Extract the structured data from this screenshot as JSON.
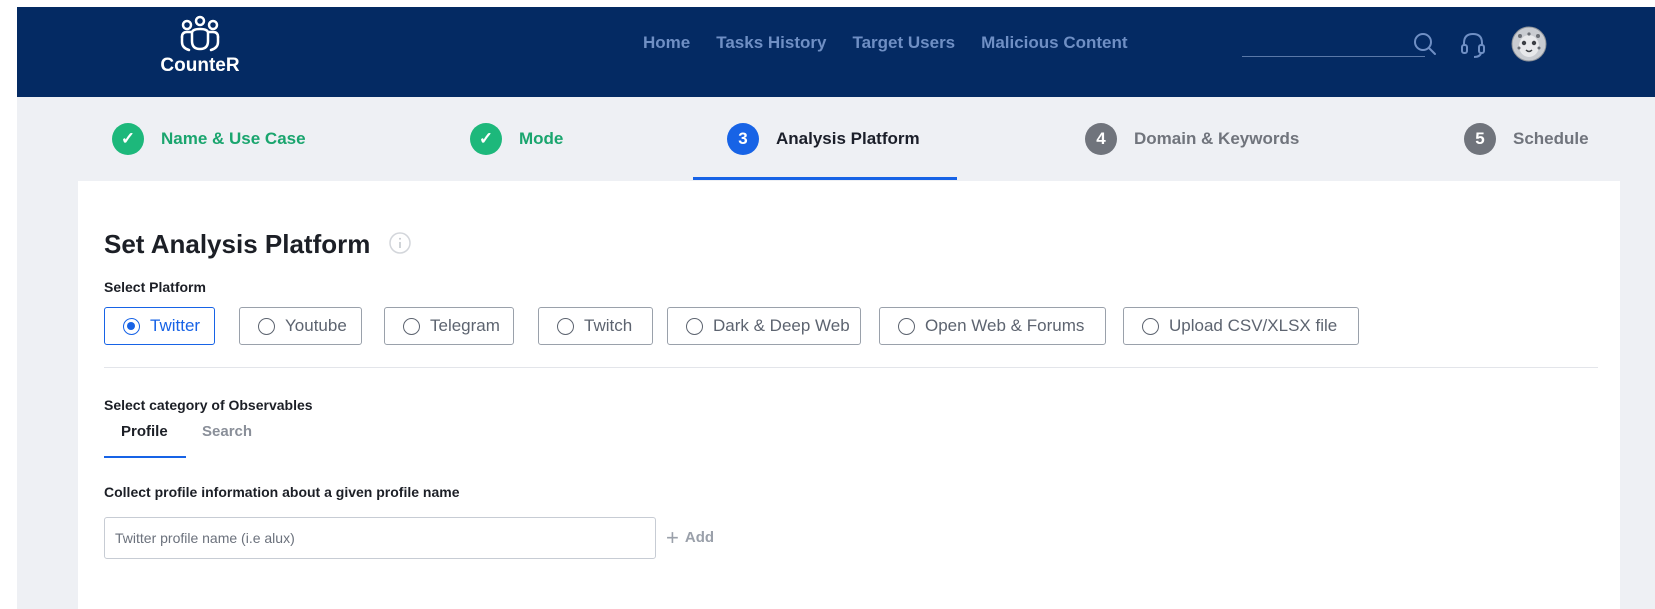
{
  "app": {
    "name": "CounteR",
    "logo_icon": "people-group-icon"
  },
  "nav": {
    "items": [
      "Home",
      "Tasks History",
      "Target Users",
      "Malicious Content"
    ],
    "icons": [
      "search-icon",
      "headset-icon",
      "avatar"
    ]
  },
  "stepper": {
    "steps": [
      {
        "badge": "✓",
        "label": "Name & Use Case",
        "state": "done"
      },
      {
        "badge": "✓",
        "label": "Mode",
        "state": "done"
      },
      {
        "badge": "3",
        "label": "Analysis Platform",
        "state": "active"
      },
      {
        "badge": "4",
        "label": "Domain & Keywords",
        "state": "pending"
      },
      {
        "badge": "5",
        "label": "Schedule",
        "state": "pending"
      }
    ]
  },
  "main": {
    "title": "Set Analysis Platform",
    "select_platform_label": "Select Platform",
    "platforms": [
      "Twitter",
      "Youtube",
      "Telegram",
      "Twitch",
      "Dark & Deep Web",
      "Open Web & Forums",
      "Upload CSV/XLSX file"
    ],
    "selected_platform": "Twitter",
    "category_label": "Select category of Observables",
    "tabs": [
      "Profile",
      "Search"
    ],
    "active_tab": "Profile",
    "collect_label": "Collect profile information about a given profile name",
    "profile_input": {
      "value": "",
      "placeholder": "Twitter profile name (i.e alux)"
    },
    "add_label": "Add"
  },
  "colors": {
    "nav_bg": "#042a63",
    "accent": "#1763e6",
    "success": "#1db87b",
    "pending": "#70747c"
  }
}
